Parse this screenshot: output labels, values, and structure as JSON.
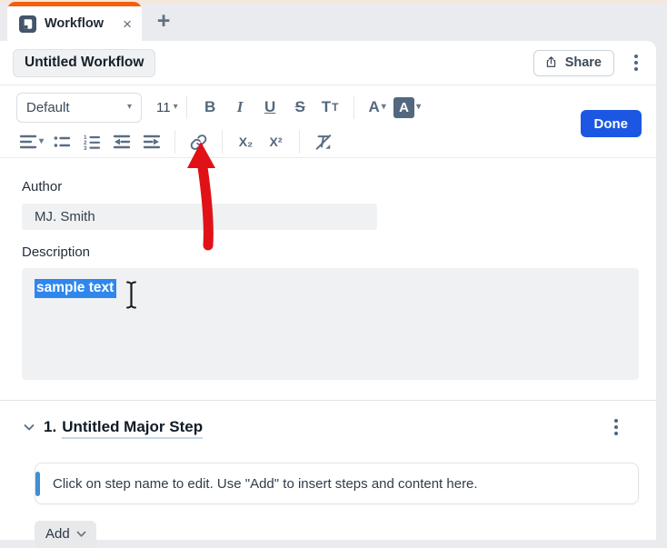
{
  "window": {
    "tab_title": "Workflow"
  },
  "icons": {
    "tab_close": "×",
    "new_tab": "+",
    "dropdown_caret": "▾"
  },
  "header": {
    "title_value": "Untitled Workflow",
    "share_label": "Share"
  },
  "toolbar": {
    "paragraph_style": "Default",
    "font_size": "11",
    "bold": "B",
    "italic": "I",
    "underline": "U",
    "strikethrough": "S",
    "tt_large": "T",
    "tt_small": "T",
    "text_color": "A",
    "highlight_color": "A",
    "subscript": "X₂",
    "superscript": "X²",
    "done_label": "Done"
  },
  "form": {
    "author_label": "Author",
    "author_value": "MJ. Smith",
    "description_label": "Description",
    "description_selected_text": "sample text"
  },
  "step": {
    "number": "1.",
    "title": "Untitled Major Step",
    "placeholder": "Click on step name to edit. Use \"Add\" to insert steps and content here.",
    "add_label": "Add"
  },
  "colors": {
    "tab_accent_orange": "#f2600e",
    "done_blue": "#1b57e3",
    "selection_blue": "#2f87ee",
    "step_accent_blue": "#3f8fd4",
    "annotation_arrow_red": "#e01217"
  }
}
